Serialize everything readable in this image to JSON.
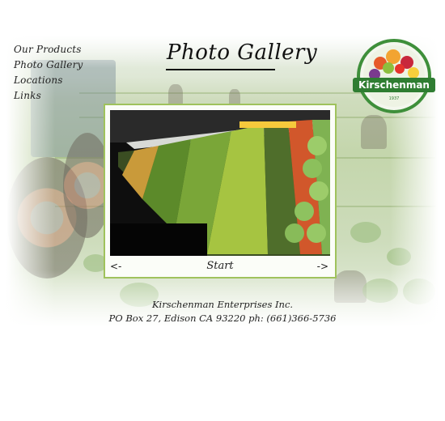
{
  "nav": {
    "items": [
      {
        "label": "Our Products"
      },
      {
        "label": "Photo Gallery"
      },
      {
        "label": "Locations"
      },
      {
        "label": "Links"
      }
    ]
  },
  "page": {
    "title": "Photo Gallery"
  },
  "logo": {
    "name": "Kirschenman",
    "year": "1937"
  },
  "gallery": {
    "prev_label": "<-",
    "start_label": "Start",
    "next_label": "->"
  },
  "footer": {
    "company": "Kirschenman Enterprises Inc.",
    "address": "PO Box 27, Edison CA 93220 ph: (661)366-5736"
  },
  "colors": {
    "frame_border": "#9fc25c",
    "logo_ring": "#3e8f3a",
    "logo_banner": "#2f7d32"
  }
}
